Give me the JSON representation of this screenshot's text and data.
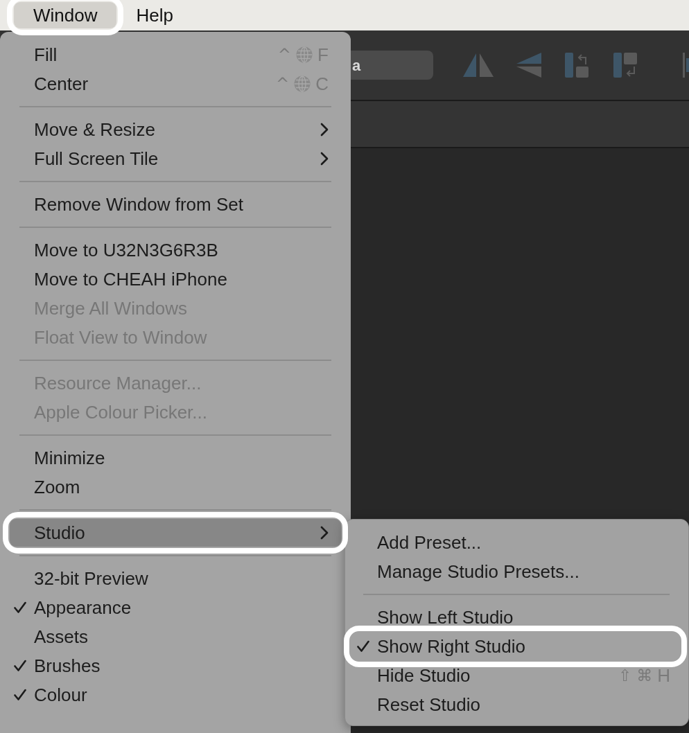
{
  "menu_bar": {
    "items": [
      {
        "label": "Window",
        "selected": true,
        "circled": true
      },
      {
        "label": "Help",
        "selected": false,
        "circled": false
      }
    ]
  },
  "toolbar": {
    "field": {
      "value": "a"
    }
  },
  "window_menu": {
    "sections": [
      {
        "items": [
          {
            "label": "Fill",
            "shortcut": [
              {
                "kind": "symbol",
                "text": "^"
              },
              {
                "kind": "globe"
              },
              {
                "kind": "key",
                "text": "F"
              }
            ],
            "submenu": false,
            "checked": false,
            "disabled": false,
            "selected": false,
            "circled": false
          },
          {
            "label": "Center",
            "shortcut": [
              {
                "kind": "symbol",
                "text": "^"
              },
              {
                "kind": "globe"
              },
              {
                "kind": "key",
                "text": "C"
              }
            ],
            "submenu": false,
            "checked": false,
            "disabled": false,
            "selected": false,
            "circled": false
          }
        ]
      },
      {
        "items": [
          {
            "label": "Move & Resize",
            "submenu": true,
            "checked": false,
            "disabled": false,
            "selected": false,
            "circled": false
          },
          {
            "label": "Full Screen Tile",
            "submenu": true,
            "checked": false,
            "disabled": false,
            "selected": false,
            "circled": false
          }
        ]
      },
      {
        "items": [
          {
            "label": "Remove Window from Set",
            "submenu": false,
            "checked": false,
            "disabled": false,
            "selected": false,
            "circled": false
          }
        ]
      },
      {
        "items": [
          {
            "label": "Move to U32N3G6R3B",
            "submenu": false,
            "checked": false,
            "disabled": false,
            "selected": false,
            "circled": false
          },
          {
            "label": "Move to CHEAH iPhone",
            "submenu": false,
            "checked": false,
            "disabled": false,
            "selected": false,
            "circled": false
          },
          {
            "label": "Merge All Windows",
            "submenu": false,
            "checked": false,
            "disabled": true,
            "selected": false,
            "circled": false
          },
          {
            "label": "Float View to Window",
            "submenu": false,
            "checked": false,
            "disabled": true,
            "selected": false,
            "circled": false
          }
        ]
      },
      {
        "items": [
          {
            "label": "Resource Manager...",
            "submenu": false,
            "checked": false,
            "disabled": true,
            "selected": false,
            "circled": false
          },
          {
            "label": "Apple Colour Picker...",
            "submenu": false,
            "checked": false,
            "disabled": true,
            "selected": false,
            "circled": false
          }
        ]
      },
      {
        "items": [
          {
            "label": "Minimize",
            "submenu": false,
            "checked": false,
            "disabled": false,
            "selected": false,
            "circled": false
          },
          {
            "label": "Zoom",
            "submenu": false,
            "checked": false,
            "disabled": false,
            "selected": false,
            "circled": false
          }
        ]
      },
      {
        "items": [
          {
            "label": "Studio",
            "submenu": true,
            "checked": false,
            "disabled": false,
            "selected": true,
            "circled": true
          }
        ]
      },
      {
        "items": [
          {
            "label": "32-bit Preview",
            "submenu": false,
            "checked": false,
            "disabled": false,
            "selected": false,
            "circled": false
          },
          {
            "label": "Appearance",
            "submenu": false,
            "checked": true,
            "disabled": false,
            "selected": false,
            "circled": false
          },
          {
            "label": "Assets",
            "submenu": false,
            "checked": false,
            "disabled": false,
            "selected": false,
            "circled": false
          },
          {
            "label": "Brushes",
            "submenu": false,
            "checked": true,
            "disabled": false,
            "selected": false,
            "circled": false
          },
          {
            "label": "Colour",
            "submenu": false,
            "checked": true,
            "disabled": false,
            "selected": false,
            "circled": false
          }
        ]
      }
    ]
  },
  "studio_submenu": {
    "sections": [
      {
        "items": [
          {
            "label": "Add Preset...",
            "submenu": false,
            "checked": false,
            "disabled": false,
            "selected": false,
            "circled": false
          },
          {
            "label": "Manage Studio Presets...",
            "submenu": false,
            "checked": false,
            "disabled": false,
            "selected": false,
            "circled": false
          }
        ]
      },
      {
        "items": [
          {
            "label": "Show Left Studio",
            "submenu": false,
            "checked": false,
            "disabled": false,
            "selected": false,
            "circled": false
          },
          {
            "label": "Show Right Studio",
            "submenu": false,
            "checked": true,
            "disabled": false,
            "selected": false,
            "circled": true
          },
          {
            "label": "Hide Studio",
            "shortcut": [
              {
                "kind": "symbol",
                "text": "⇧"
              },
              {
                "kind": "symbol",
                "text": "⌘"
              },
              {
                "kind": "key",
                "text": "H"
              }
            ],
            "submenu": false,
            "checked": false,
            "disabled": false,
            "selected": false,
            "circled": false
          },
          {
            "label": "Reset Studio",
            "submenu": false,
            "checked": false,
            "disabled": false,
            "selected": false,
            "circled": false
          }
        ]
      }
    ]
  }
}
